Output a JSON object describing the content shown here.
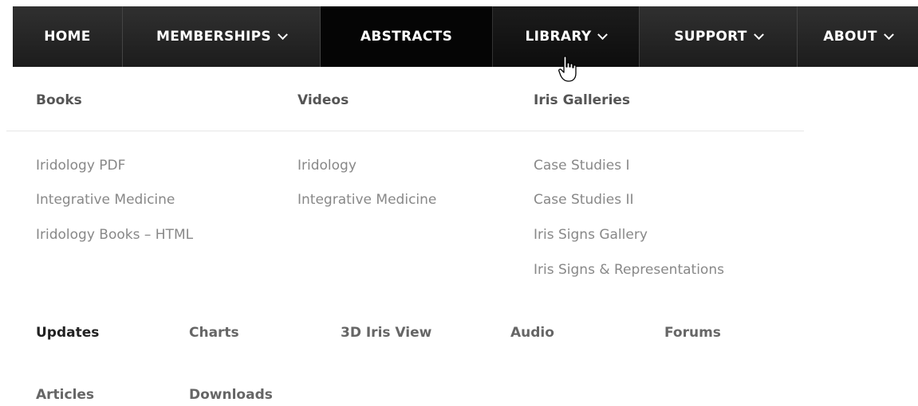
{
  "nav": {
    "items": [
      {
        "label": "HOME",
        "has_chevron": false
      },
      {
        "label": "MEMBERSHIPS",
        "has_chevron": true
      },
      {
        "label": "ABSTRACTS",
        "has_chevron": false
      },
      {
        "label": "LIBRARY",
        "has_chevron": true
      },
      {
        "label": "SUPPORT",
        "has_chevron": true
      },
      {
        "label": "ABOUT",
        "has_chevron": true
      }
    ],
    "active": "ABSTRACTS",
    "hovered": "LIBRARY"
  },
  "dropdown": {
    "columns": [
      {
        "heading": "Books",
        "links": [
          "Iridology PDF",
          "Integrative Medicine",
          "Iridology Books – HTML"
        ]
      },
      {
        "heading": "Videos",
        "links": [
          "Iridology",
          "Integrative Medicine"
        ]
      },
      {
        "heading": "Iris Galleries",
        "links": [
          "Case Studies I",
          "Case Studies II",
          "Iris Signs Gallery",
          "Iris Signs & Representations"
        ]
      }
    ],
    "bottom_links": [
      "Updates",
      "Charts",
      "3D Iris View",
      "Audio",
      "Forums",
      "Articles",
      "Downloads"
    ]
  },
  "colors": {
    "nav_bg": "#262626",
    "nav_active_bg": "#050505",
    "heading_text": "#555555",
    "link_text": "#888888"
  },
  "icons": {
    "chevron": "chevron-down-icon",
    "cursor": "hand-pointer-icon"
  }
}
